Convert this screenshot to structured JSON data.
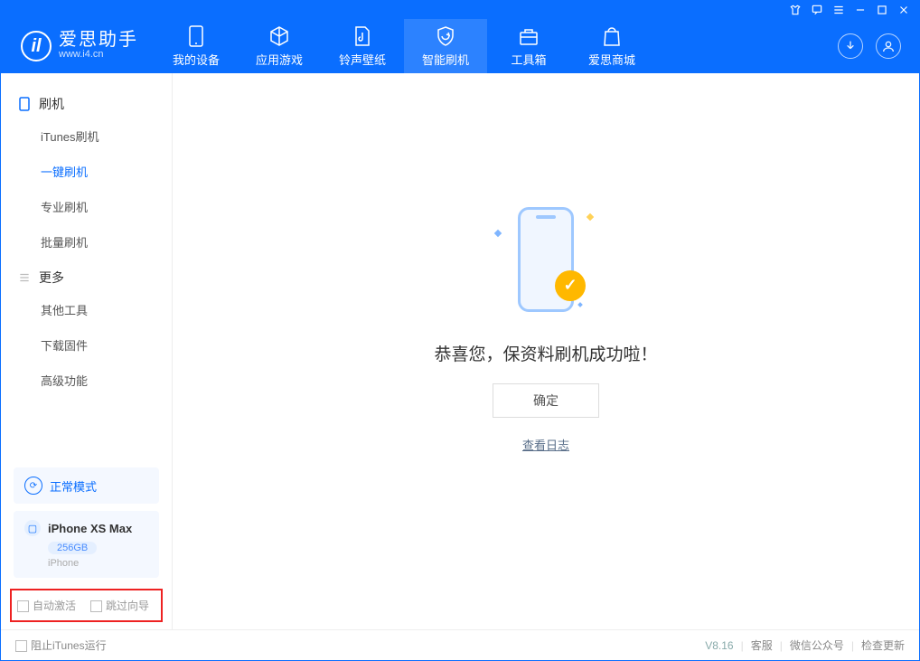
{
  "app": {
    "name": "爱思助手",
    "url": "www.i4.cn"
  },
  "nav": {
    "items": [
      {
        "label": "我的设备"
      },
      {
        "label": "应用游戏"
      },
      {
        "label": "铃声壁纸"
      },
      {
        "label": "智能刷机"
      },
      {
        "label": "工具箱"
      },
      {
        "label": "爱思商城"
      }
    ]
  },
  "sidebar": {
    "group1": {
      "title": "刷机",
      "items": [
        "iTunes刷机",
        "一键刷机",
        "专业刷机",
        "批量刷机"
      ],
      "active_index": 1
    },
    "group2": {
      "title": "更多",
      "items": [
        "其他工具",
        "下载固件",
        "高级功能"
      ]
    },
    "mode": {
      "label": "正常模式"
    },
    "device": {
      "name": "iPhone XS Max",
      "capacity": "256GB",
      "type": "iPhone"
    },
    "options": {
      "auto_activate": "自动激活",
      "skip_guide": "跳过向导"
    }
  },
  "content": {
    "success_text": "恭喜您，保资料刷机成功啦！",
    "ok_button": "确定",
    "log_link": "查看日志"
  },
  "statusbar": {
    "block_itunes": "阻止iTunes运行",
    "version": "V8.16",
    "links": [
      "客服",
      "微信公众号",
      "检查更新"
    ]
  }
}
